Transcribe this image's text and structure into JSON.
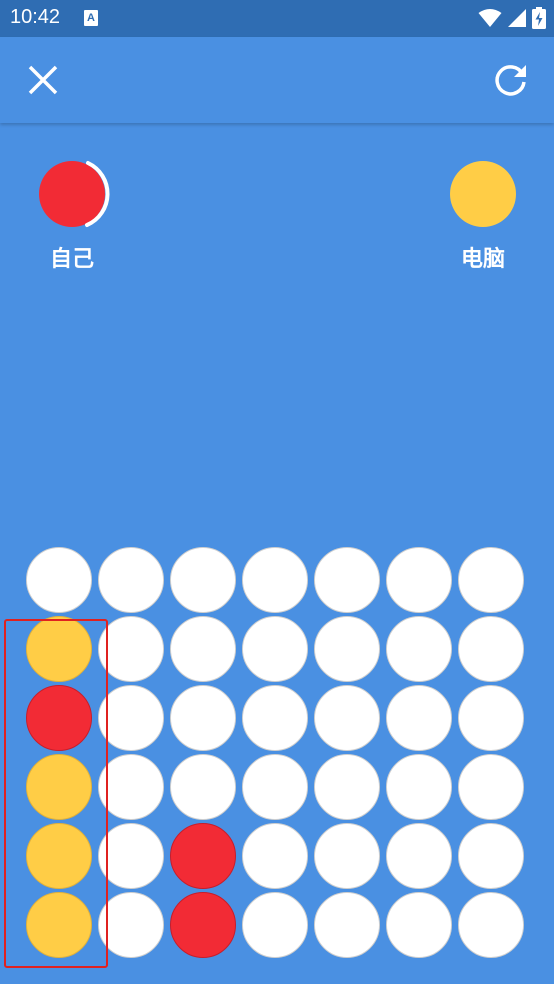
{
  "status_bar": {
    "time": "10:42",
    "notification_icon": "a-badge-icon",
    "icons": [
      "wifi-icon",
      "signal-icon",
      "battery-charging-icon"
    ]
  },
  "toolbar": {
    "close_icon": "close-icon",
    "restart_icon": "refresh-icon"
  },
  "players": {
    "self": {
      "name": "自己",
      "color": "#f22b35",
      "active": true
    },
    "computer": {
      "name": "电脑",
      "color": "#ffcd46",
      "active": false
    }
  },
  "board": {
    "columns": 7,
    "rows": 6,
    "cells": [
      [
        "empty",
        "empty",
        "empty",
        "empty",
        "empty",
        "empty",
        "empty"
      ],
      [
        "yellow",
        "empty",
        "empty",
        "empty",
        "empty",
        "empty",
        "empty"
      ],
      [
        "red",
        "empty",
        "empty",
        "empty",
        "empty",
        "empty",
        "empty"
      ],
      [
        "yellow",
        "empty",
        "empty",
        "empty",
        "empty",
        "empty",
        "empty"
      ],
      [
        "yellow",
        "empty",
        "red",
        "empty",
        "empty",
        "empty",
        "empty"
      ],
      [
        "yellow",
        "empty",
        "red",
        "empty",
        "empty",
        "empty",
        "empty"
      ]
    ],
    "highlight": {
      "column": 1,
      "row_from": 2,
      "row_to": 6
    }
  },
  "colors": {
    "background": "#4a90e2",
    "status_bar": "#2f6db3",
    "red": "#f22b35",
    "yellow": "#ffcd46",
    "highlight": "#e0211f"
  }
}
